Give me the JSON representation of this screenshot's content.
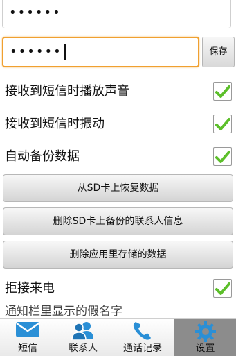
{
  "password_top": {
    "value": "••••••"
  },
  "password_edit": {
    "value": "••••••"
  },
  "save_button": {
    "label": "保存"
  },
  "settings": [
    {
      "label": "接收到短信时播放声音",
      "checked": true
    },
    {
      "label": "接收到短信时振动",
      "checked": true
    },
    {
      "label": "自动备份数据",
      "checked": true
    }
  ],
  "actions": [
    {
      "label": "从SD卡上恢复数据"
    },
    {
      "label": "删除SD卡上备份的联系人信息"
    },
    {
      "label": "删除应用里存储的数据"
    }
  ],
  "reject_calls": {
    "label": "拒接来电",
    "checked": true
  },
  "fake_name_row": {
    "label": "通知栏里显示的假名字"
  },
  "tabs": [
    {
      "label": "短信",
      "icon": "envelope-icon",
      "active": false
    },
    {
      "label": "联系人",
      "icon": "contacts-icon",
      "active": false
    },
    {
      "label": "通话记录",
      "icon": "phone-icon",
      "active": false
    },
    {
      "label": "设置",
      "icon": "gear-icon",
      "active": true
    }
  ],
  "colors": {
    "focus_border": "#f0a030",
    "check_green": "#5cbf2a",
    "icon_blue": "#2a8fd6",
    "active_tab": "#8c8c8c"
  }
}
